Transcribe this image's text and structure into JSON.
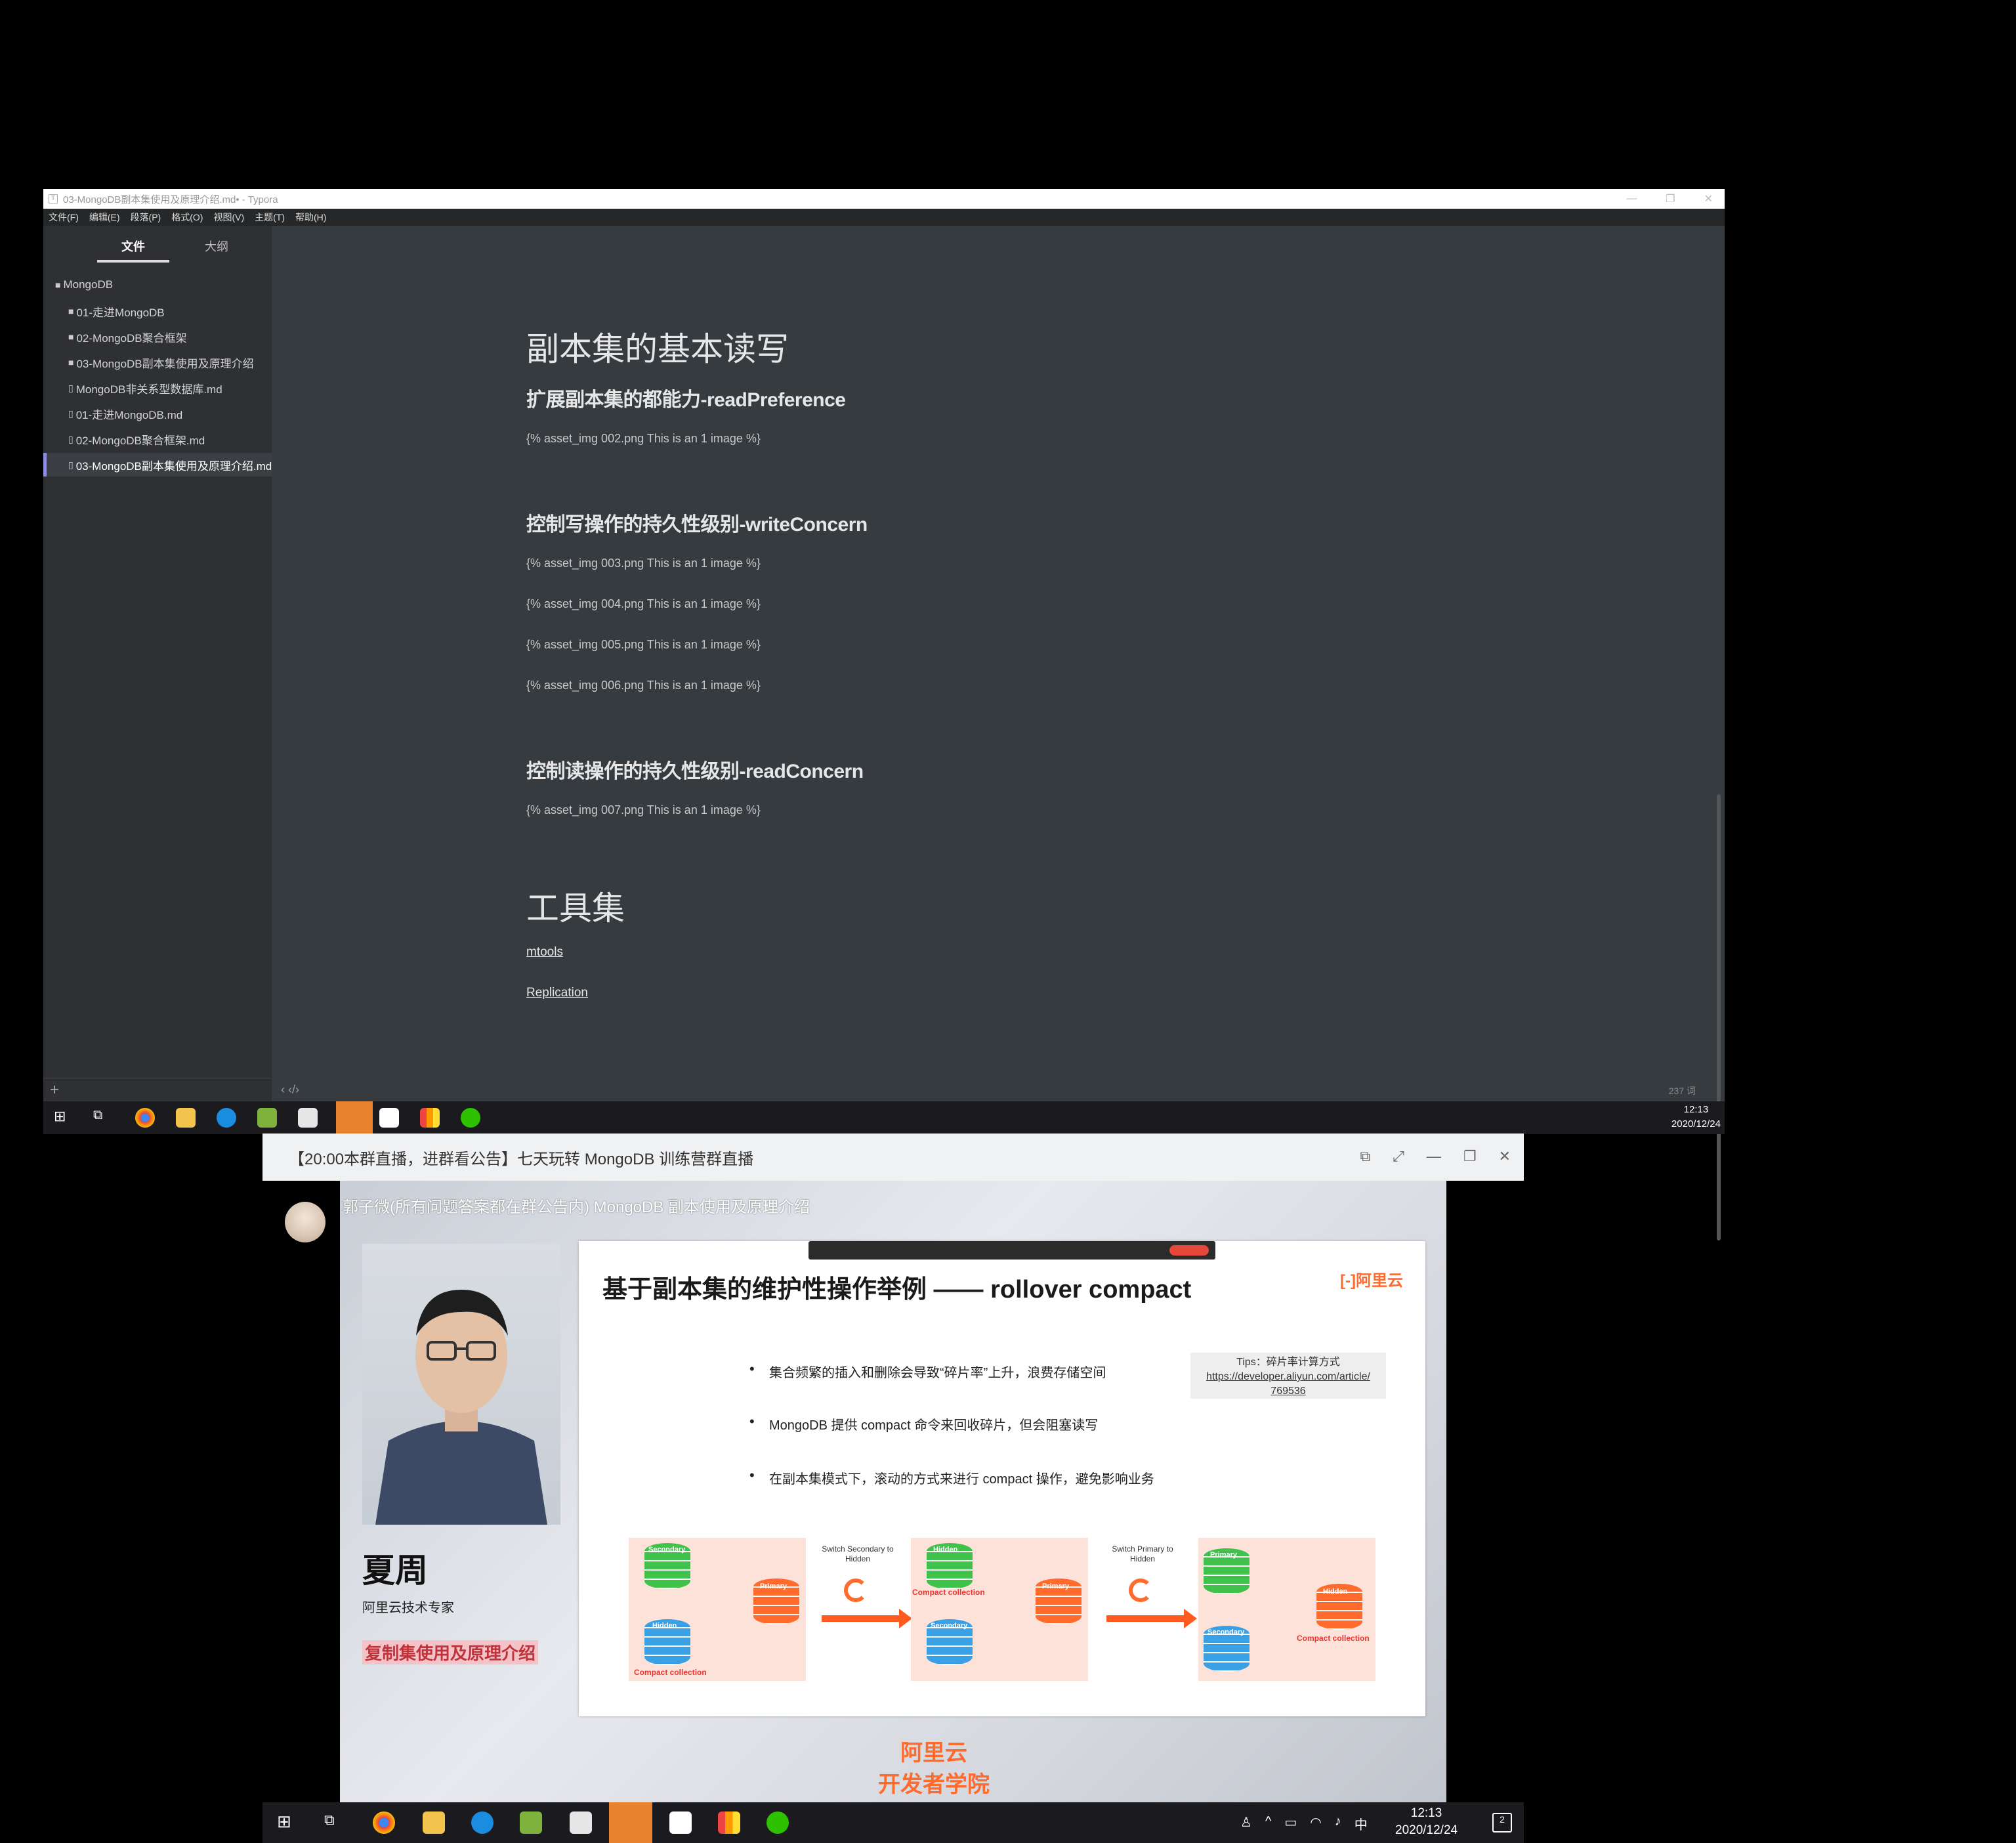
{
  "typora": {
    "window_title": "03-MongoDB副本集使用及原理介绍.md• - Typora",
    "menu": [
      "文件(F)",
      "编辑(E)",
      "段落(P)",
      "格式(O)",
      "视图(V)",
      "主题(T)",
      "帮助(H)"
    ],
    "sidebar": {
      "tab_files": "文件",
      "tab_outline": "大纲",
      "items": [
        {
          "label": "MongoDB",
          "kind": "folder"
        },
        {
          "label": "01-走进MongoDB",
          "kind": "folder"
        },
        {
          "label": "02-MongoDB聚合框架",
          "kind": "folder"
        },
        {
          "label": "03-MongoDB副本集使用及原理介绍",
          "kind": "folder"
        },
        {
          "label": "MongoDB非关系型数据库.md",
          "kind": "file"
        },
        {
          "label": "01-走进MongoDB.md",
          "kind": "file"
        },
        {
          "label": "02-MongoDB聚合框架.md",
          "kind": "file"
        },
        {
          "label": "03-MongoDB副本集使用及原理介绍.md",
          "kind": "file",
          "active": true
        }
      ],
      "add_label": "+"
    },
    "content": {
      "h1_replica": "副本集的基本读写",
      "h2_read_pref": "扩展副本集的都能力-readPreference",
      "img002": "{% asset_img 002.png This is an 1 image %}",
      "h2_write_concern": "控制写操作的持久性级别-writeConcern",
      "img003": "{% asset_img 003.png This is an 1 image %}",
      "img004": "{% asset_img 004.png This is an 1 image %}",
      "img005": "{% asset_img 005.png This is an 1 image %}",
      "img006": "{% asset_img 006.png This is an 1 image %}",
      "h2_read_concern": "控制读操作的持久性级别-readConcern",
      "img007": "{% asset_img 007.png This is an 1 image %}",
      "h1_tools": "工具集",
      "link_mtools": "mtools",
      "link_replication": "Replication"
    },
    "status": {
      "left": "‹  ‹/›",
      "word_count": "237 词"
    }
  },
  "taskbar_top": {
    "time": "12:13",
    "date": "2020/12/24"
  },
  "stream": {
    "window_title": "【20:00本群直播，进群看公告】七天玩转 MongoDB 训练营群直播",
    "caption": "郭子微(所有问题答案都在群公告内) MongoDB 副本使用及原理介绍",
    "speaker_name": "夏周",
    "speaker_role": "阿里云技术专家",
    "speaker_topic": "复制集使用及原理介绍",
    "brand_bottom_1": "阿里云",
    "brand_bottom_2": "开发者学院",
    "slide": {
      "title": "基于副本集的维护性操作举例 —— rollover compact",
      "logo": "[-]阿里云",
      "bullets": [
        "集合频繁的插入和删除会导致“碎片率”上升，浪费存储空间",
        "MongoDB 提供 compact 命令来回收碎片，但会阻塞读写",
        "在副本集模式下，滚动的方式来进行 compact 操作，避免影响业务"
      ],
      "tips_label": "Tips：碎片率计算方式",
      "tips_url_1": "https://developer.aliyun.com/article/",
      "tips_url_2": "769536",
      "arrow1_label": "Switch Secondary to Hidden",
      "arrow2_label": "Switch Primary to Hidden",
      "db_secondary": "Secondary",
      "db_primary": "Primary",
      "db_hidden": "Hidden",
      "compact_collection": "Compact collection"
    }
  },
  "taskbar_bottom": {
    "time": "12:13",
    "date": "2020/12/24",
    "ime": "中",
    "notifications": "2"
  },
  "colors": {
    "typora_bg": "#363b40",
    "sidebar_bg": "#2e3033",
    "accent_orange": "#ff6a2d",
    "primary_green": "#3fc14b",
    "secondary_blue": "#3aa0e6"
  }
}
